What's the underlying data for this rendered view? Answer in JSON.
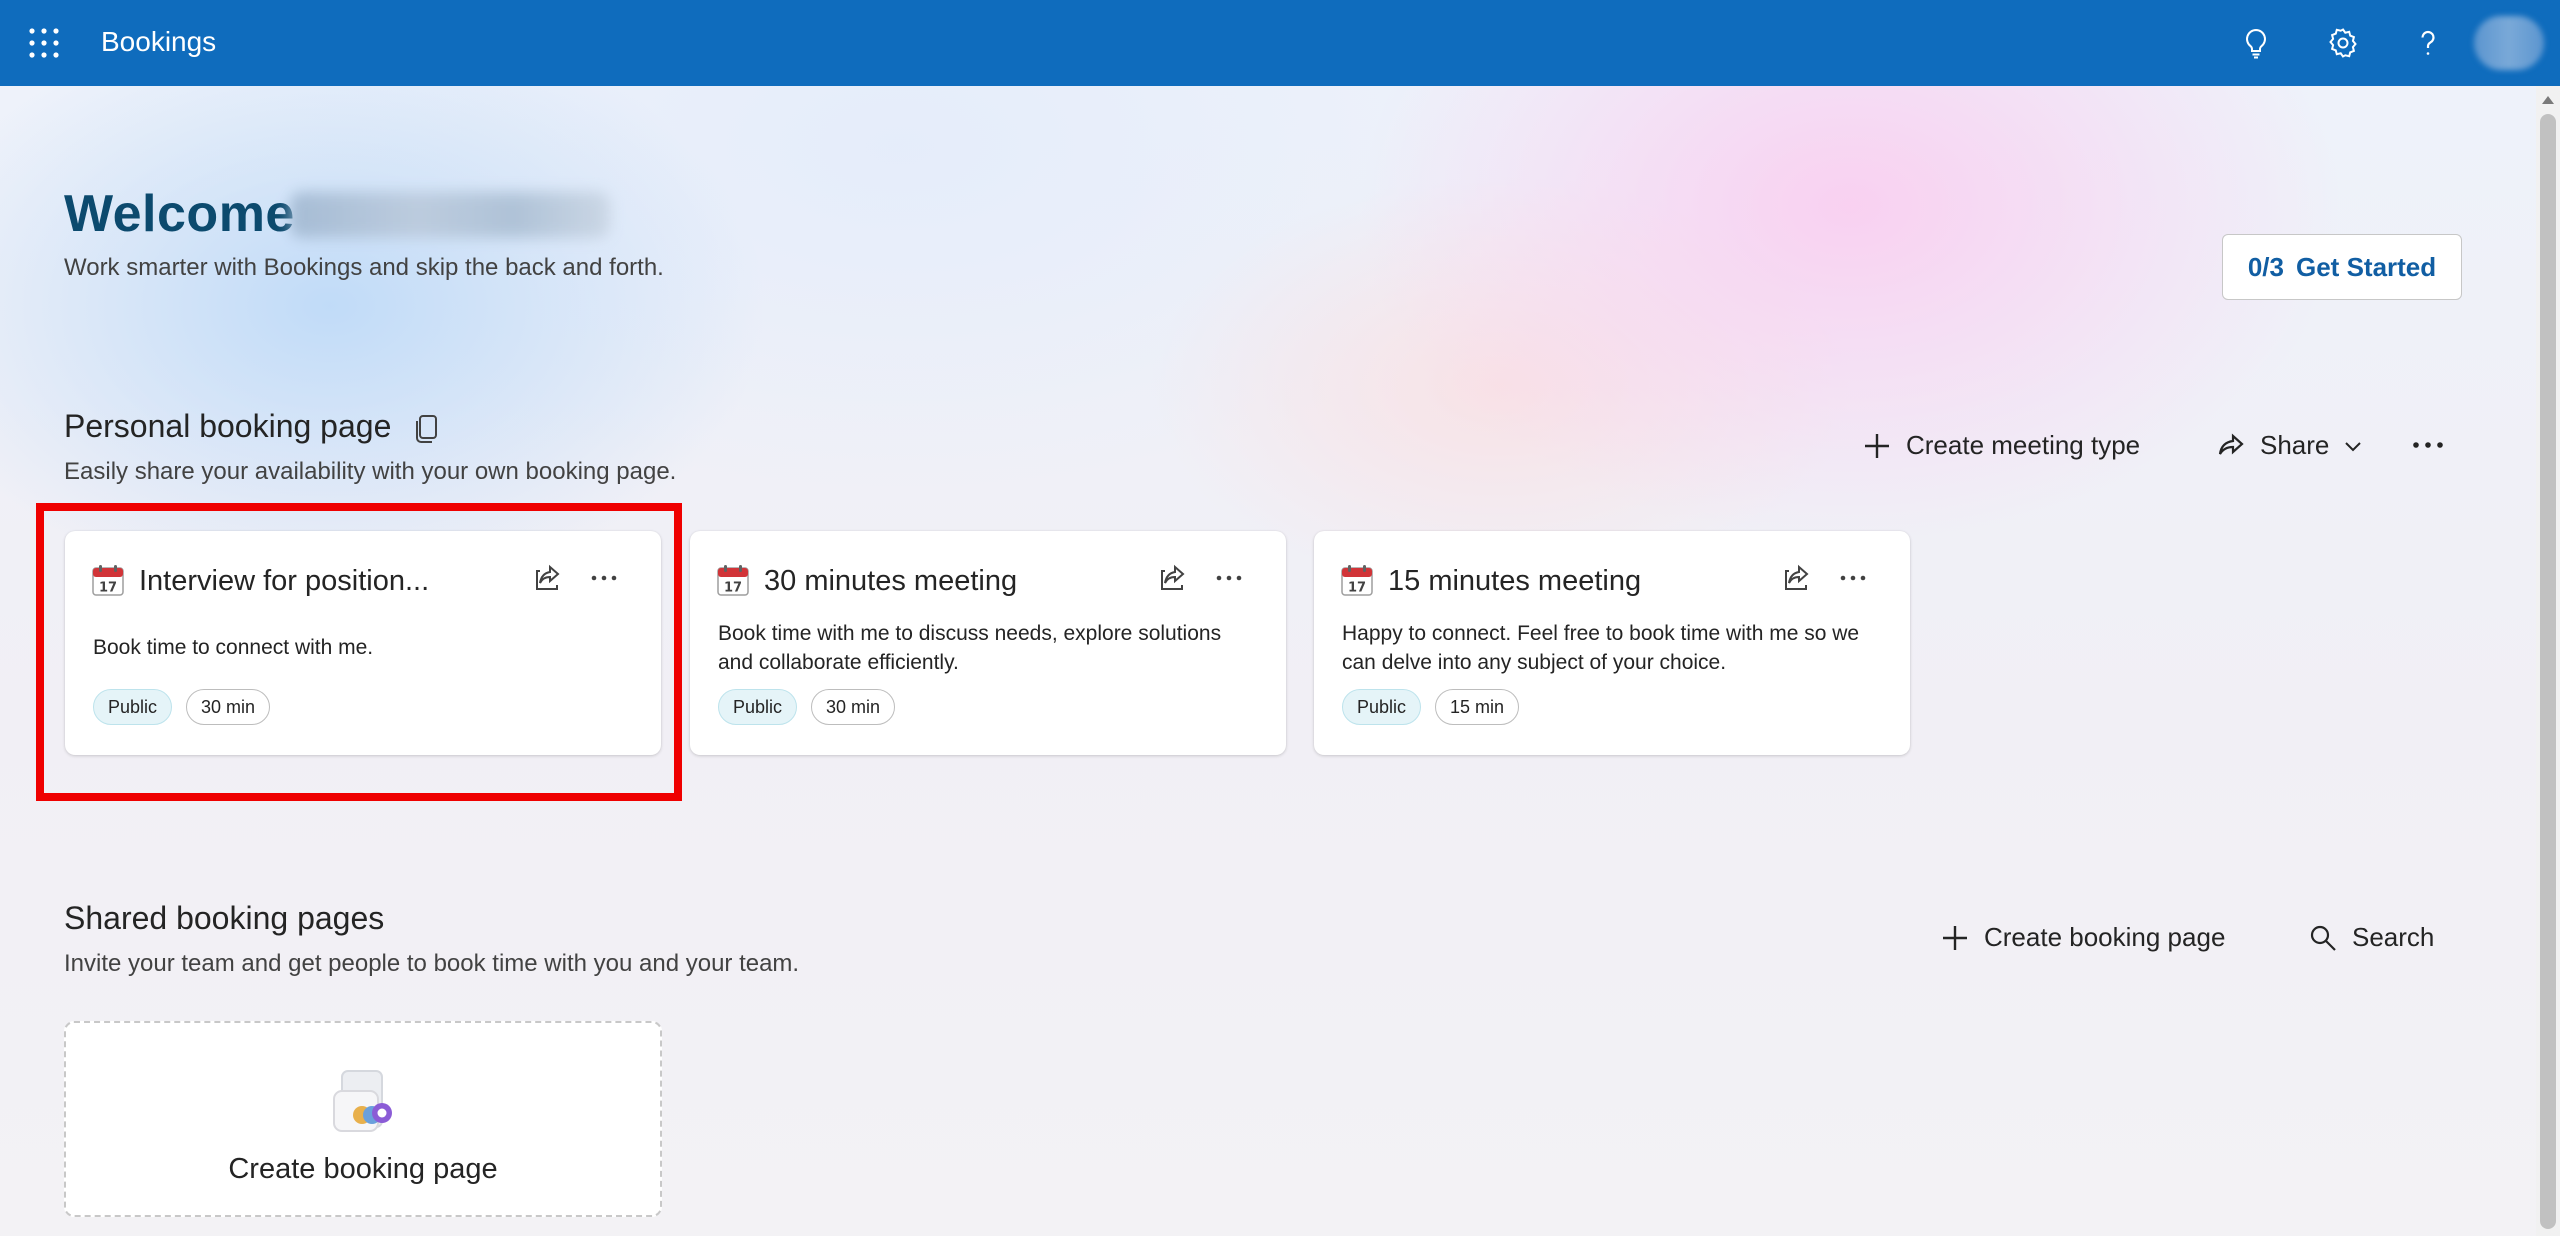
{
  "topbar": {
    "app_title": "Bookings",
    "icons": [
      "waffle-icon",
      "lightbulb-icon",
      "gear-icon",
      "help-icon",
      "avatar"
    ],
    "color": "#0f6cbd"
  },
  "welcome": {
    "title": "Welcome",
    "subtitle": "Work smarter with Bookings and skip the back and forth.",
    "get_started_progress": "0/3",
    "get_started_label": "Get Started"
  },
  "personal": {
    "title": "Personal booking page",
    "subtitle": "Easily share your availability with your own booking page.",
    "actions": {
      "create_meeting_type": "Create meeting type",
      "share": "Share"
    },
    "cards": [
      {
        "title": "Interview for position...",
        "description": "Book time to connect with me.",
        "visibility": "Public",
        "duration": "30 min"
      },
      {
        "title": "30 minutes meeting",
        "description": "Book time with me to discuss needs, explore solutions and collaborate efficiently.",
        "visibility": "Public",
        "duration": "30 min"
      },
      {
        "title": "15 minutes meeting",
        "description": "Happy to connect. Feel free to book time with me so we can delve into any subject of your choice.",
        "visibility": "Public",
        "duration": "15 min"
      }
    ]
  },
  "shared": {
    "title": "Shared booking pages",
    "subtitle": "Invite your team and get people to book time with you and your team.",
    "actions": {
      "create_booking_page": "Create booking page",
      "search": "Search"
    },
    "create_card_label": "Create booking page"
  },
  "colors": {
    "brand": "#0f6cbd",
    "welcome_title": "#0c4a6e",
    "link": "#115ea3",
    "highlight": "#ef0000"
  }
}
